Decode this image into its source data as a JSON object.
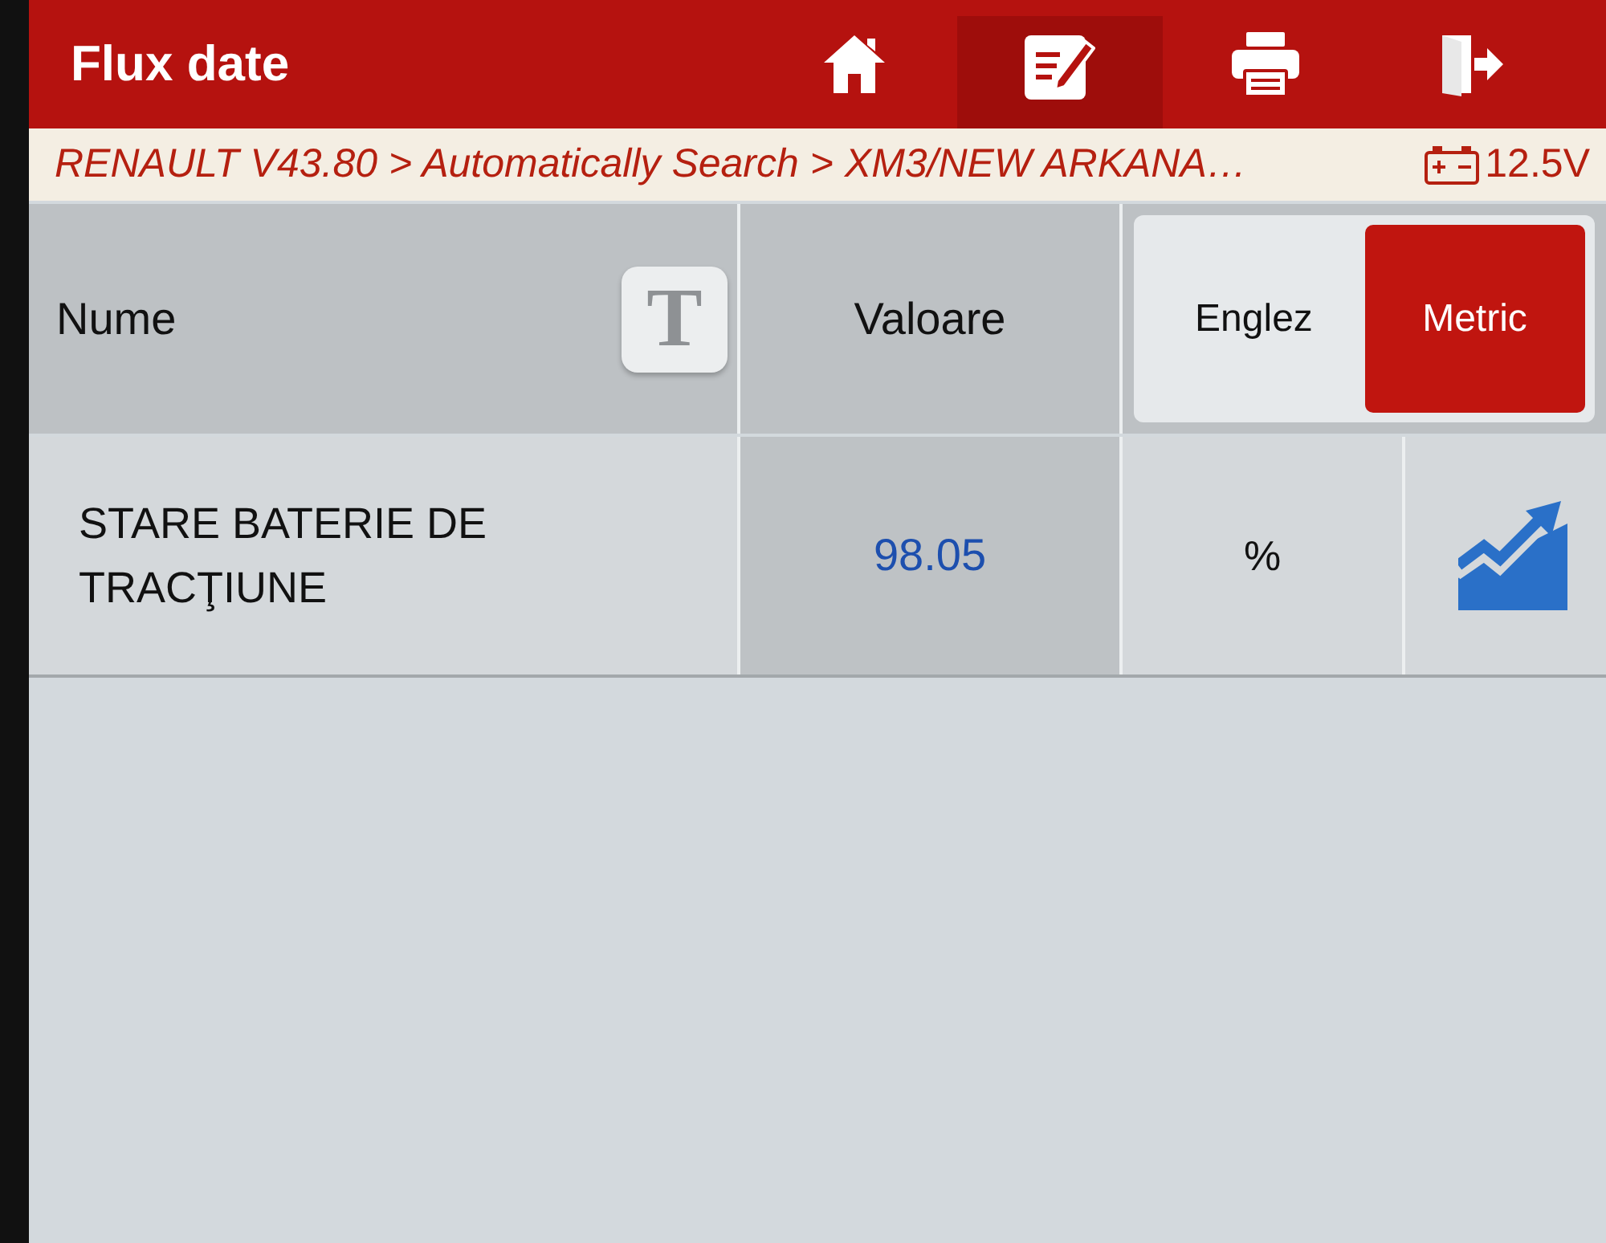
{
  "title_bar": {
    "title": "Flux date",
    "toolbar": [
      {
        "kind": "home",
        "selected": false
      },
      {
        "kind": "edit",
        "selected": true
      },
      {
        "kind": "print",
        "selected": false
      },
      {
        "kind": "exit",
        "selected": false
      }
    ]
  },
  "breadcrumb": {
    "path": "RENAULT V43.80 > Automatically Search > XM3/NEW ARKANA…",
    "voltage": "12.5V"
  },
  "table": {
    "columns": [
      {
        "label": "Nume"
      },
      {
        "label": "Valoare"
      }
    ],
    "font_button": {
      "label": "T"
    },
    "unit_toggle": [
      {
        "label": "Englez",
        "selected": false
      },
      {
        "label": "Metric",
        "selected": true
      }
    ],
    "rows": [
      {
        "name": "STARE BATERIE DE TRACŢIUNE",
        "value": "98.05",
        "unit": "%"
      }
    ]
  }
}
